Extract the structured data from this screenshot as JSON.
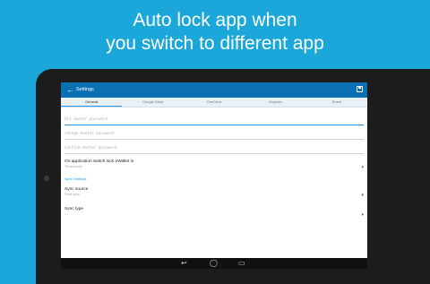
{
  "promo": {
    "line1": "Auto lock app when",
    "line2": "you switch to different app"
  },
  "appbar": {
    "back_icon": "arrow-left-icon",
    "title": "Settings",
    "save_icon": "save-icon"
  },
  "tabs": [
    {
      "label": "General",
      "active": true
    },
    {
      "label": "Google Drive",
      "active": false
    },
    {
      "label": "OneDrive",
      "active": false
    },
    {
      "label": "Dropbox",
      "active": false
    },
    {
      "label": "Reset",
      "active": false
    }
  ],
  "fields": {
    "old_password": "Old master password",
    "change_password": "change master password",
    "confirm_password": "Confirm master password"
  },
  "settings": {
    "lock_label": "On application switch lock eWallet in",
    "lock_value": "15 seconds",
    "sync_section": "Sync Settings",
    "sync_source_label": "Sync source",
    "sync_source_value": "Dont sync",
    "sync_type_label": "Sync type",
    "sync_type_value": "—"
  },
  "navbar": {
    "back_icon": "back-triangle-icon",
    "home_icon": "home-icon",
    "recents_icon": "recents-icon"
  },
  "colors": {
    "background": "#1ba7da",
    "appbar": "#0b6fb3",
    "accent": "#2196f3"
  }
}
